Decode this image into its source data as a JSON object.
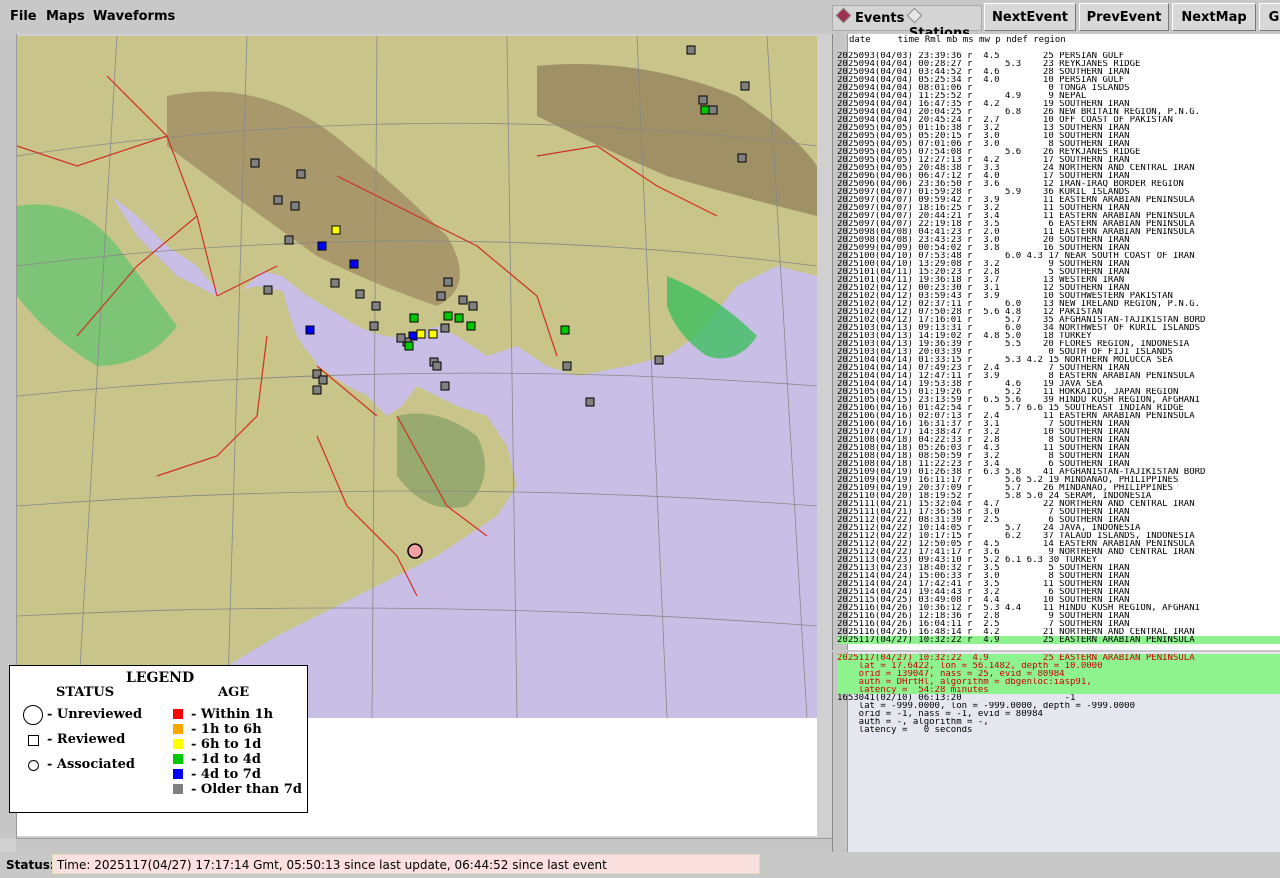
{
  "menu": {
    "file": "File",
    "maps": "Maps",
    "waveforms": "Waveforms"
  },
  "toolbar": {
    "events_label": "Events",
    "stations_label": "Stations",
    "next_event": "NextEvent",
    "prev_event": "PrevEvent",
    "next_map": "NextMap",
    "cut_button": "G"
  },
  "legend": {
    "title": "LEGEND",
    "status_heading": "STATUS",
    "age_heading": "AGE",
    "status_items": [
      "- Unreviewed",
      "- Reviewed",
      "- Associated"
    ],
    "age_items": [
      {
        "label": "- Within 1h",
        "color": "#ff0000"
      },
      {
        "label": "- 1h to 6h",
        "color": "#ffa500"
      },
      {
        "label": "- 6h to 1d",
        "color": "#ffff00"
      },
      {
        "label": "- 1d to 4d",
        "color": "#00c800"
      },
      {
        "label": "- 4d to 7d",
        "color": "#0000ff"
      },
      {
        "label": "- Older than 7d",
        "color": "#808080"
      }
    ]
  },
  "event_list": {
    "header": "date     time Rml mb ms mw p ndef region",
    "rows": [
      "2025093(04/03) 23:39:36 r  4.5        25 PERSIAN GULF",
      "2025094(04/04) 00:28:27 r      5.3    23 REYKJANES RIDGE",
      "2025094(04/04) 03:44:52 r  4.6        28 SOUTHERN IRAN",
      "2025094(04/04) 05:25:34 r  4.0        10 PERSIAN GULF",
      "2025094(04/04) 08:01:06 r              0 TONGA ISLANDS",
      "2025094(04/04) 11:25:52 r      4.9     9 NEPAL",
      "2025094(04/04) 16:47:35 r  4.2        19 SOUTHERN IRAN",
      "2025094(04/04) 20:04:25 r      6.8    26 NEW BRITAIN REGION, P.N.G.",
      "2025094(04/04) 20:45:24 r  2.7        10 OFF COAST OF PAKISTAN",
      "2025095(04/05) 01:16:38 r  3.2        13 SOUTHERN IRAN",
      "2025095(04/05) 05:20:15 r  3.0        10 SOUTHERN IRAN",
      "2025095(04/05) 07:01:06 r  3.0         8 SOUTHERN IRAN",
      "2025095(04/05) 07:54:08 r      5.6    26 REYKJANES RIDGE",
      "2025095(04/05) 12:27:13 r  4.2        17 SOUTHERN IRAN",
      "2025095(04/05) 20:48:38 r  3.3        24 NORTHERN AND CENTRAL IRAN",
      "2025096(04/06) 06:47:12 r  4.0        17 SOUTHERN IRAN",
      "2025096(04/06) 23:36:50 r  3.6        12 IRAN-IRAQ BORDER REGION",
      "2025097(04/07) 01:59:28 r      5.9    36 KURIL ISLANDS",
      "2025097(04/07) 09:59:42 r  3.9        11 EASTERN ARABIAN PENINSULA",
      "2025097(04/07) 18:16:25 r  3.2        11 SOUTHERN IRAN",
      "2025097(04/07) 20:44:21 r  3.4        11 EASTERN ARABIAN PENINSULA",
      "2025097(04/07) 22:19:18 r  3.5         6 EASTERN ARABIAN PENINSULA",
      "2025098(04/08) 04:41:23 r  2.0        11 EASTERN ARABIAN PENINSULA",
      "2025098(04/08) 23:43:23 r  3.0        20 SOUTHERN IRAN",
      "2025099(04/09) 00:54:02 r  3.8        16 SOUTHERN IRAN",
      "2025100(04/10) 07:53:48 r      6.0 4.3 17 NEAR SOUTH COAST OF IRAN",
      "2025100(04/10) 13:29:08 r  3.2         9 SOUTHERN IRAN",
      "2025101(04/11) 15:20:23 r  2.8         5 SOUTHERN IRAN",
      "2025101(04/11) 19:36:18 r  3.7        13 WESTERN IRAN",
      "2025102(04/12) 00:23:30 r  3.1        12 SOUTHERN IRAN",
      "2025102(04/12) 03:59:43 r  3.9        10 SOUTHWESTERN PAKISTAN",
      "2025102(04/12) 02:37:11 r      6.0    13 NEW IRELAND REGION, P.N.G.",
      "2025102(04/12) 07:50:28 r  5.6 4.8    12 PAKISTAN",
      "2025102(04/12) 17:16:01 r      5.7    35 AFGHANISTAN-TAJIKISTAN BORD",
      "2025103(04/13) 09:13:31 r      6.0    34 NORTHWEST OF KURIL ISLANDS",
      "2025103(04/13) 14:19:02 r  4.8 5.0    18 TURKEY",
      "2025103(04/13) 19:36:39 r      5.5    20 FLORES REGION, INDONESIA",
      "2025103(04/13) 20:03:39 r              0 SOUTH OF FIJI ISLANDS",
      "2025104(04/14) 01:33:15 r      5.3 4.2 15 NORTHERN MOLUCCA SEA",
      "2025104(04/14) 07:49:23 r  2.4         7 SOUTHERN IRAN",
      "2025104(04/14) 12:47:11 r  3.9         8 EASTERN ARABIAN PENINSULA",
      "2025104(04/14) 19:53:38 r      4.6    19 JAVA SEA",
      "2025105(04/15) 01:19:26 r      5.2    11 HOKKAIDO, JAPAN REGION",
      "2025105(04/15) 23:13:59 r  6.5 5.6    39 HINDU KUSH REGION, AFGHANI",
      "2025106(04/16) 01:42:54 r      5.7 6.6 15 SOUTHEAST INDIAN RIDGE",
      "2025106(04/16) 02:07:13 r  2.4        11 EASTERN ARABIAN PENINSULA",
      "2025106(04/16) 16:31:37 r  3.1         7 SOUTHERN IRAN",
      "2025107(04/17) 14:38:47 r  3.2        10 SOUTHERN IRAN",
      "2025108(04/18) 04:22:33 r  2.8         8 SOUTHERN IRAN",
      "2025108(04/18) 05:26:03 r  4.3        11 SOUTHERN IRAN",
      "2025108(04/18) 08:50:59 r  3.2         8 SOUTHERN IRAN",
      "2025108(04/18) 11:22:23 r  3.4         6 SOUTHERN IRAN",
      "2025109(04/19) 01:26:38 r  6.3 5.8    41 AFGHANISTAN-TAJIKISTAN BORD",
      "2025109(04/19) 16:11:17 r      5.6 5.2 19 MINDANAO, PHILIPPINES",
      "2025109(04/19) 20:37:09 r      5.7    26 MINDANAO, PHILIPPINES",
      "2025110(04/20) 18:19:52 r      5.8 5.0 24 SERAM, INDONESIA",
      "2025111(04/21) 15:32:04 r  4.7        22 NORTHERN AND CENTRAL IRAN",
      "2025111(04/21) 17:36:58 r  3.0         7 SOUTHERN IRAN",
      "2025112(04/22) 08:31:39 r  2.5         6 SOUTHERN IRAN",
      "2025112(04/22) 10:14:05 r      5.7    24 JAVA, INDONESIA",
      "2025112(04/22) 10:17:15 r      6.2    37 TALAUD ISLANDS, INDONESIA",
      "2025112(04/22) 12:50:05 r  4.5        14 EASTERN ARABIAN PENINSULA",
      "2025112(04/22) 17:41:17 r  3.6         9 NORTHERN AND CENTRAL IRAN",
      "2025113(04/23) 09:43:10 r  5.2 6.1 6.3 30 TURKEY",
      "2025113(04/23) 18:40:32 r  3.5         5 SOUTHERN IRAN",
      "2025114(04/24) 15:06:33 r  3.0         8 SOUTHERN IRAN",
      "2025114(04/24) 17:42:41 r  3.5        11 SOUTHERN IRAN",
      "2025114(04/24) 19:44:43 r  3.2         6 SOUTHERN IRAN",
      "2025115(04/25) 03:49:08 r  4.4        10 SOUTHERN IRAN",
      "2025116(04/26) 10:36:12 r  5.3 4.4    11 HINDU KUSH REGION, AFGHANI",
      "2025116(04/26) 12:18:36 r  2.8         9 SOUTHERN IRAN",
      "2025116(04/26) 16:04:11 r  2.5         7 SOUTHERN IRAN",
      "2025116(04/26) 16:48:14 r  4.2        21 NORTHERN AND CENTRAL IRAN"
    ],
    "selected_row": "2025117(04/27) 10:32:22 r  4.9        25 EASTERN ARABIAN PENINSULA"
  },
  "detail": {
    "green_lines": [
      "2025117(04/27) 10:32:22  4.9          25 EASTERN ARABIAN PENINSULA",
      "    lat = 17.6422, lon = 56.1482, depth = 10.0000",
      "    orid = 139047, nass = 25, evid = 80984",
      "    auth = DHrtHl, algorithm = dbgenloc:iasp91,",
      "    latency =  54:28 minutes"
    ],
    "plain_lines": [
      "1653041(02/10) 06:13:20                   -1",
      "    lat = -999.0000, lon = -999.0000, depth = -999.0000",
      "    orid = -1, nass = -1, evid = 80984",
      "    auth = -, algorithm = -,",
      "    latency =   0 seconds"
    ]
  },
  "status": {
    "label": "Status:",
    "text": "Time: 2025117(04/27) 17:17:14 Gmt, 05:50:13 since last update, 06:44:52 since last event"
  },
  "colors": {
    "sea": "#c9bfe6",
    "selected_green": "#8ef28e",
    "status_pink": "#fbe0e0"
  }
}
